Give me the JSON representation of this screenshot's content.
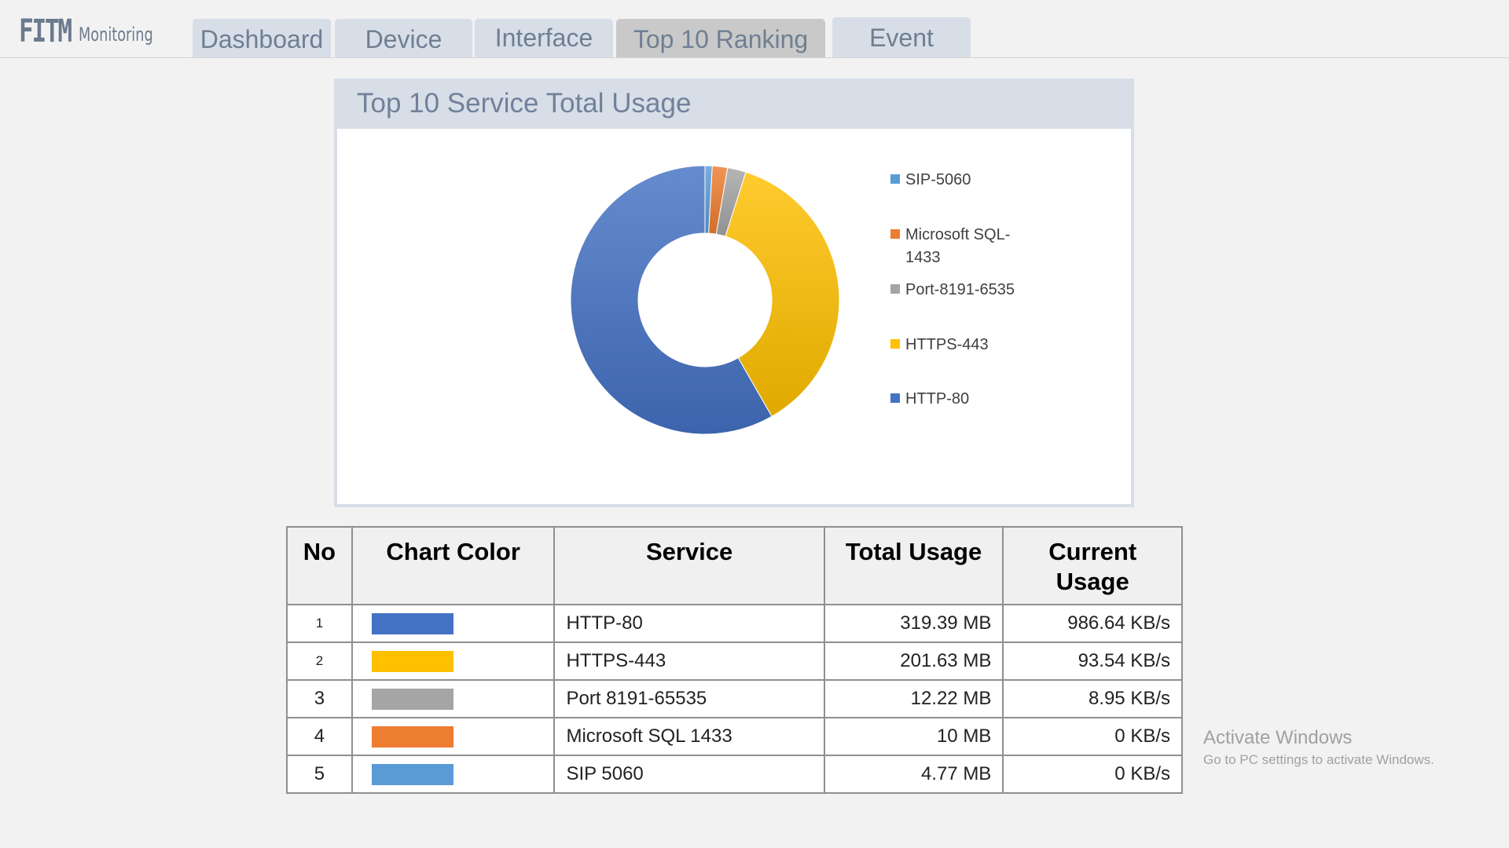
{
  "header": {
    "logo_main": "FITM",
    "logo_sub": "Monitoring",
    "tabs": [
      {
        "label": "Dashboard",
        "active": false
      },
      {
        "label": "Device",
        "active": false
      },
      {
        "label": "Interface",
        "active": false
      },
      {
        "label": "Top 10 Ranking",
        "active": true
      },
      {
        "label": "Event",
        "active": false
      }
    ]
  },
  "chart_panel": {
    "title": "Top 10 Service Total Usage"
  },
  "chart_data": {
    "type": "pie",
    "donut": true,
    "title": "",
    "legend_placement": "right",
    "legend": [
      {
        "label_lines": [
          "SIP-5060"
        ],
        "color": "#5B9BD5"
      },
      {
        "label_lines": [
          "Microsoft SQL-",
          "1433"
        ],
        "color": "#ED7D31"
      },
      {
        "label_lines": [
          "Port-8191-6535"
        ],
        "color": "#A5A5A5"
      },
      {
        "label_lines": [
          "HTTPS-443"
        ],
        "color": "#FFC000"
      },
      {
        "label_lines": [
          "HTTP-80"
        ],
        "color": "#4472C4"
      }
    ],
    "slices": [
      {
        "label": "SIP-5060",
        "value": 4.77,
        "color": "#5B9BD5"
      },
      {
        "label": "Microsoft SQL-1433",
        "value": 10,
        "color": "#ED7D31"
      },
      {
        "label": "Port-8191-6535",
        "value": 12.22,
        "color": "#A5A5A5"
      },
      {
        "label": "HTTPS-443",
        "value": 201.63,
        "color": "#FFC000"
      },
      {
        "label": "HTTP-80",
        "value": 319.39,
        "color": "#4472C4"
      }
    ]
  },
  "table": {
    "headers": {
      "no": "No",
      "chart_color": "Chart Color",
      "service": "Service",
      "total_usage": "Total Usage",
      "current_usage_line1": "Current",
      "current_usage_line2": "Usage"
    },
    "rows": [
      {
        "no": "1",
        "color": "#4472C4",
        "service": "HTTP-80",
        "total": "319.39 MB",
        "current": "986.64  KB/s"
      },
      {
        "no": "2",
        "color": "#FFC000",
        "service": "HTTPS-443",
        "total": "201.63 MB",
        "current": "93.54 KB/s"
      },
      {
        "no": "3",
        "color": "#A5A5A5",
        "service": "Port 8191-65535",
        "total": "12.22 MB",
        "current": "8.95 KB/s"
      },
      {
        "no": "4",
        "color": "#ED7D31",
        "service": "Microsoft SQL 1433",
        "total": "10 MB",
        "current": "0 KB/s"
      },
      {
        "no": "5",
        "color": "#5B9BD5",
        "service": "SIP 5060",
        "total": "4.77 MB",
        "current": "0 KB/s"
      }
    ]
  },
  "watermark": {
    "title": "Activate Windows",
    "subtitle": "Go to PC settings to activate Windows."
  }
}
